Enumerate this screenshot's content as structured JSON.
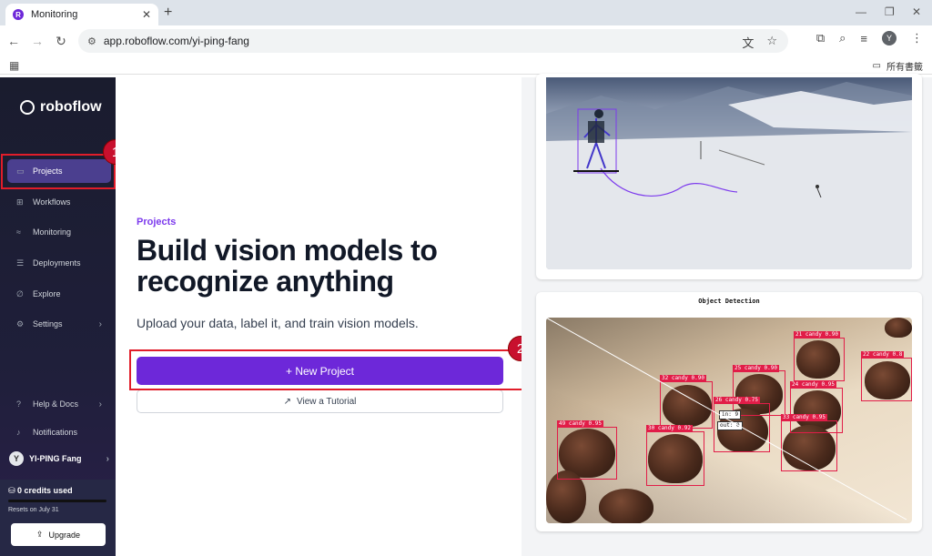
{
  "browser": {
    "tab_title": "Monitoring",
    "tab_favicon": "roboflow-icon",
    "url": "app.roboflow.com/yi-ping-fang",
    "bookmark_folder": "所有書籤",
    "profile_initial": "Y"
  },
  "sidebar": {
    "brand": "roboflow",
    "items": [
      {
        "label": "Projects",
        "icon": "laptop-icon",
        "active": true
      },
      {
        "label": "Workflows",
        "icon": "workflow-icon"
      },
      {
        "label": "Monitoring",
        "icon": "chart-icon"
      },
      {
        "label": "Deployments",
        "icon": "server-icon"
      },
      {
        "label": "Explore",
        "icon": "compass-icon"
      },
      {
        "label": "Settings",
        "icon": "gear-icon",
        "chevron": true
      },
      {
        "label": "Help & Docs",
        "icon": "help-icon",
        "chevron": true
      },
      {
        "label": "Notifications",
        "icon": "bell-icon"
      }
    ],
    "user": {
      "initial": "Y",
      "name": "YI-PING Fang"
    },
    "credits": {
      "title": "0 credits used",
      "reset": "Resets on July 31",
      "fraction_used": 0
    },
    "upgrade_label": "Upgrade"
  },
  "main": {
    "eyebrow": "Projects",
    "headline": "Build vision models to recognize anything",
    "subtext": "Upload your data, label it, and train vision models.",
    "new_project_label": "+ New Project",
    "tutorial_label": "View a Tutorial"
  },
  "annotations": {
    "badge1": "1",
    "badge2": "2"
  },
  "preview": {
    "object_detection_title": "Object Detection",
    "labels": [
      "21 candy 0.90",
      "22 candy 0.8",
      "32 candy 0.90",
      "25 candy 0.90",
      "24 candy 0.95",
      "26 candy 0.75",
      "33 candy 0.95",
      "30 candy 0.92",
      "49 candy 0.95"
    ],
    "count_in": "in: 9",
    "count_out": "out: 0"
  },
  "colors": {
    "accent": "#6d28d9",
    "highlight": "#e11d2a",
    "sidebar": "#1a1c2e"
  }
}
